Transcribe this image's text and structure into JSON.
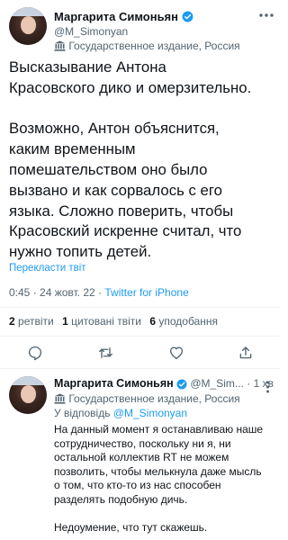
{
  "main_tweet": {
    "author_name": "Маргарита Симоньян",
    "handle": "@M_Simonyan",
    "state_media_label": "Государственное издание, Россия",
    "text_lines": [
      "Высказывание Антона",
      "Красовского дико и омерзительно.",
      "",
      "Возможно, Антон объяснится,",
      "каким временным",
      "помешательством оно было",
      "вызвано и как сорвалось с его",
      "языка. Сложно поверить, чтобы",
      "Красовский искренне считал, что",
      "нужно топить детей."
    ],
    "translate_link": "Перекласти твіт",
    "timestamp": "0:45 · 24 жовт. 22 ·",
    "source": "Twitter for iPhone",
    "stats": {
      "retweets_count": "2",
      "retweets_label": "ретвіти",
      "quotes_count": "1",
      "quotes_label": "цитовані твіти",
      "likes_count": "6",
      "likes_label": "уподобання"
    }
  },
  "reply_tweet": {
    "author_name": "Маргарита Симоньян",
    "handle": "@M_Sim...",
    "time": "· 1 хв",
    "state_media_label": "Государственное издание, Россия",
    "reply_prefix": "У відповідь",
    "reply_to": "@M_Simonyan",
    "text_lines": [
      "На данный момент я останавливаю наше",
      "сотрудничество, поскольку ни я, ни",
      "остальной коллектив RT не можем",
      "позволить, чтобы  мелькнула даже мысль",
      "о том, что кто-то из нас способен",
      "разделять  подобную дичь.",
      "",
      "Недоумение, что тут скажешь."
    ]
  },
  "colors": {
    "accent": "#1d9bf0",
    "secondary_text": "#536471",
    "divider": "#eff3f4"
  },
  "icons": {
    "more": "more-icon",
    "verified": "verified-badge-icon",
    "government": "government-building-icon",
    "reply": "reply-icon",
    "retweet": "retweet-icon",
    "like": "heart-icon",
    "share": "share-icon"
  }
}
